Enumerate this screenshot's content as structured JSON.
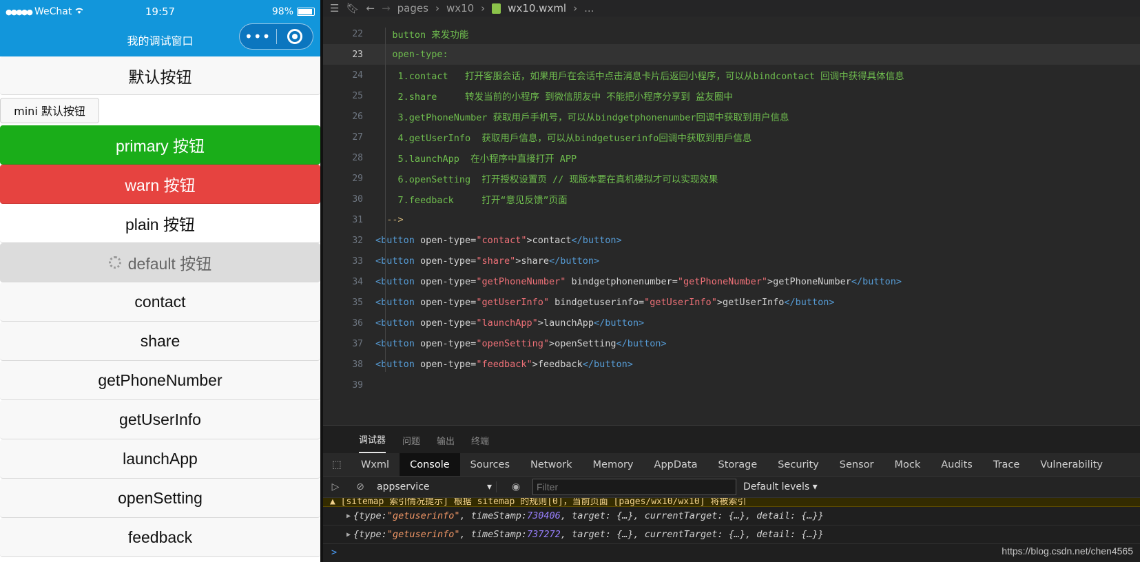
{
  "simulator": {
    "status": {
      "carrier": "WeChat",
      "signal_dots": "●●●●●",
      "time": "19:57",
      "battery": "98%"
    },
    "nav_title": "我的调试窗口",
    "capsule_more": "•••",
    "buttons": {
      "default": "默认按钮",
      "mini": "mini 默认按钮",
      "primary": "primary 按钮",
      "warn": "warn 按钮",
      "plain": "plain 按钮",
      "loading": "default 按钮",
      "contact": "contact",
      "share": "share",
      "getPhoneNumber": "getPhoneNumber",
      "getUserInfo": "getUserInfo",
      "launchApp": "launchApp",
      "openSetting": "openSetting",
      "feedback": "feedback"
    },
    "colors": {
      "nav": "#1296db",
      "primary": "#1aad19",
      "warn": "#e64340"
    }
  },
  "editor": {
    "breadcrumb": [
      "pages",
      "wx10",
      "wx10.wxml",
      "..."
    ],
    "lines": [
      {
        "n": "22",
        "text": "   button 来发功能"
      },
      {
        "n": "23",
        "text": "   open-type:"
      },
      {
        "n": "24",
        "text": "    1.contact   打开客服会话，如果用戶在会话中点击消息卡片后返回小程序，可以从bindcontact 回调中获得具体信息"
      },
      {
        "n": "25",
        "text": "    2.share     转发当前的小程序 到微信朋友中 不能把小程序分享到 盆友圈中"
      },
      {
        "n": "26",
        "text": "    3.getPhoneNumber 获取用戶手机号，可以从bindgetphonenumber回调中获取到用户信息"
      },
      {
        "n": "27",
        "text": "    4.getUserInfo  获取用戶信息，可以从bindgetuserinfo回调中获取到用戶信息"
      },
      {
        "n": "28",
        "text": "    5.launchApp  在小程序中直接打开 APP"
      },
      {
        "n": "29",
        "text": "    6.openSetting  打开授权设置页 // 现版本要在真机模拟才可以实现效果"
      },
      {
        "n": "30",
        "text": "    7.feedback     打开“意见反馈”页面"
      },
      {
        "n": "31",
        "text": "  -->"
      },
      {
        "n": "32",
        "open": "<button",
        "attr": " open-type=",
        "val": "\"contact\"",
        "rest": ">contact",
        "close": "</button>"
      },
      {
        "n": "33",
        "open": "<button",
        "attr": " open-type=",
        "val": "\"share\"",
        "rest": ">share",
        "close": "</button>"
      },
      {
        "n": "34",
        "open": "<button",
        "attr": " open-type=",
        "val": "\"getPhoneNumber\"",
        "attr2": " bindgetphonenumber=",
        "val2": "\"getPhoneNumber\"",
        "rest": ">getPhoneNumber",
        "close": "</button>"
      },
      {
        "n": "35",
        "open": "<button",
        "attr": " open-type=",
        "val": "\"getUserInfo\"",
        "attr2": " bindgetuserinfo=",
        "val2": "\"getUserInfo\"",
        "rest": ">getUserInfo",
        "close": "</button>"
      },
      {
        "n": "36",
        "open": "<button",
        "attr": " open-type=",
        "val": "\"launchApp\"",
        "rest": ">launchApp",
        "close": "</button>"
      },
      {
        "n": "37",
        "open": "<button",
        "attr": " open-type=",
        "val": "\"openSetting\"",
        "rest": ">openSetting",
        "close": "</button>"
      },
      {
        "n": "38",
        "open": "<button",
        "attr": " open-type=",
        "val": "\"feedback\"",
        "rest": ">feedback",
        "close": "</button>"
      },
      {
        "n": "39",
        "text": ""
      }
    ]
  },
  "devtools": {
    "panels": [
      "调试器",
      "问题",
      "输出",
      "终端"
    ],
    "tabs": [
      "Wxml",
      "Console",
      "Sources",
      "Network",
      "Memory",
      "AppData",
      "Storage",
      "Security",
      "Sensor",
      "Mock",
      "Audits",
      "Trace",
      "Vulnerability"
    ],
    "context": "appservice",
    "filter_placeholder": "Filter",
    "levels": "Default levels",
    "warning": "[sitemap 索引情况提示] 根据 sitemap 的规则[0]，当前页面 [pages/wx10/wx10] 将被索引",
    "logs": [
      {
        "type": "\"getuserinfo\"",
        "timeStamp": "730406"
      },
      {
        "type": "\"getuserinfo\"",
        "timeStamp": "737272"
      }
    ],
    "log_rest": ", target: {…}, currentTarget: {…}, detail: {…}}",
    "prompt": ">"
  },
  "watermark": "https://blog.csdn.net/chen4565"
}
